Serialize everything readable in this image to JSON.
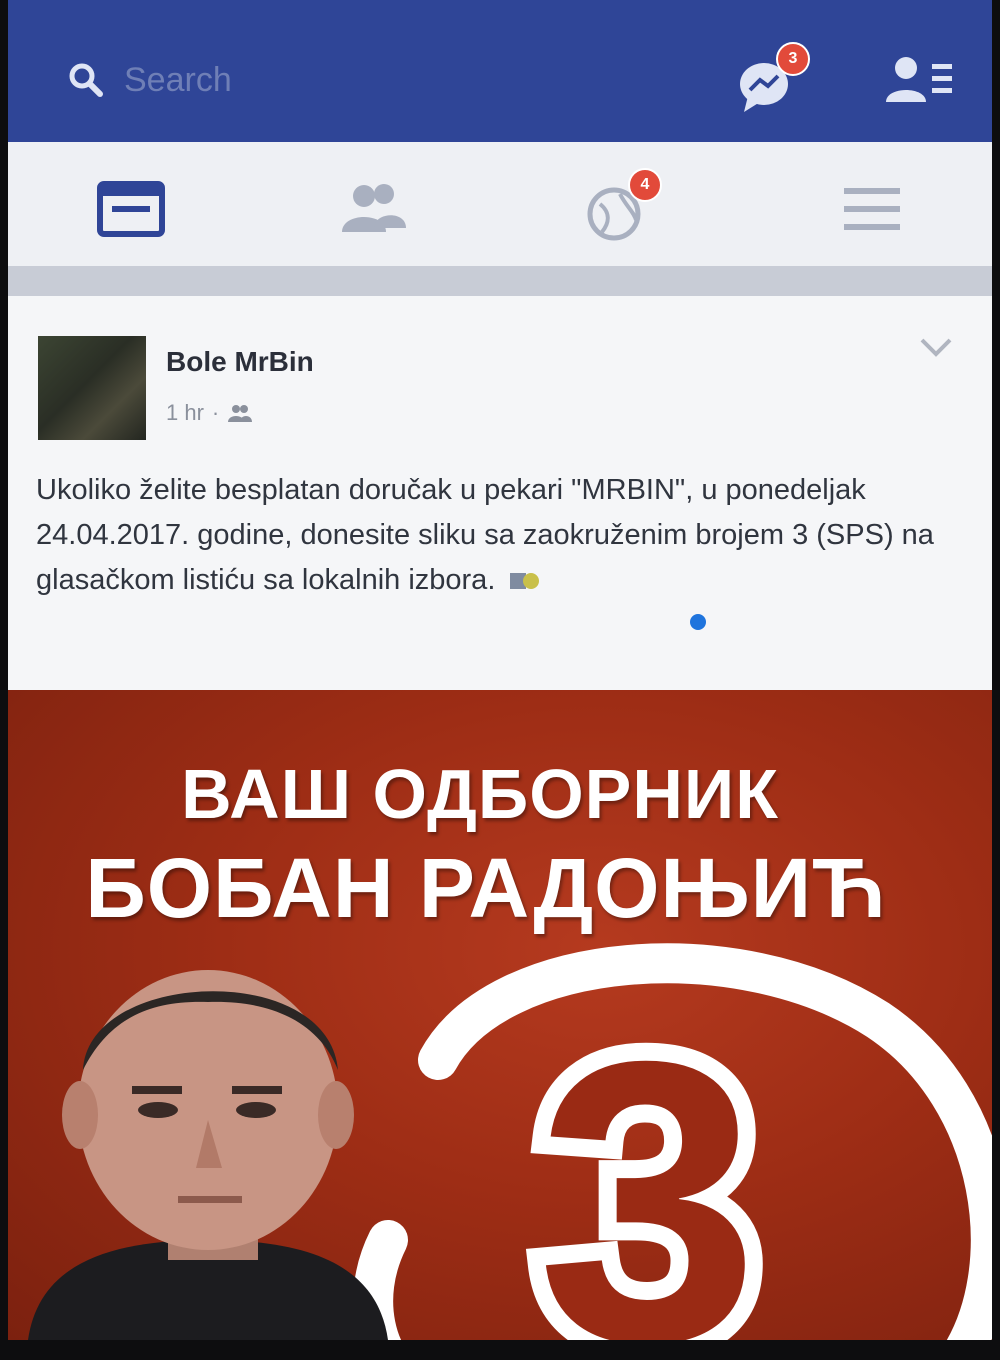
{
  "topbar": {
    "search": {
      "placeholder": "Search",
      "icon": "search-icon"
    },
    "messenger": {
      "icon": "messenger-icon",
      "badge": "3"
    },
    "friend_requests": {
      "icon": "friend-requests-icon"
    }
  },
  "nav": {
    "tabs": [
      {
        "icon": "news-feed-icon",
        "active": true
      },
      {
        "icon": "friends-icon"
      },
      {
        "icon": "notifications-globe-icon",
        "badge": "4"
      },
      {
        "icon": "menu-icon"
      }
    ]
  },
  "post": {
    "author": "Bole MrBin",
    "time": "1 hr",
    "separator": "·",
    "audience_icon": "friends-audience-icon",
    "text": "Ukoliko želite besplatan doručak u pekari \"MRBIN\", u ponedeljak 24.04.2017. godine, donesite sliku sa zaokruženim brojem 3 (SPS) na glasačkom listiću sa lokalnih izbora."
  },
  "poster": {
    "line1": "ВАШ ОДБОРНИК",
    "line2": "БОБАН РАДОЊИЋ",
    "number": "3"
  },
  "colors": {
    "topbar": "#2f4597",
    "nav_active": "#2f4597",
    "badge": "#e24a3a",
    "poster_red": "#9e2d15"
  }
}
